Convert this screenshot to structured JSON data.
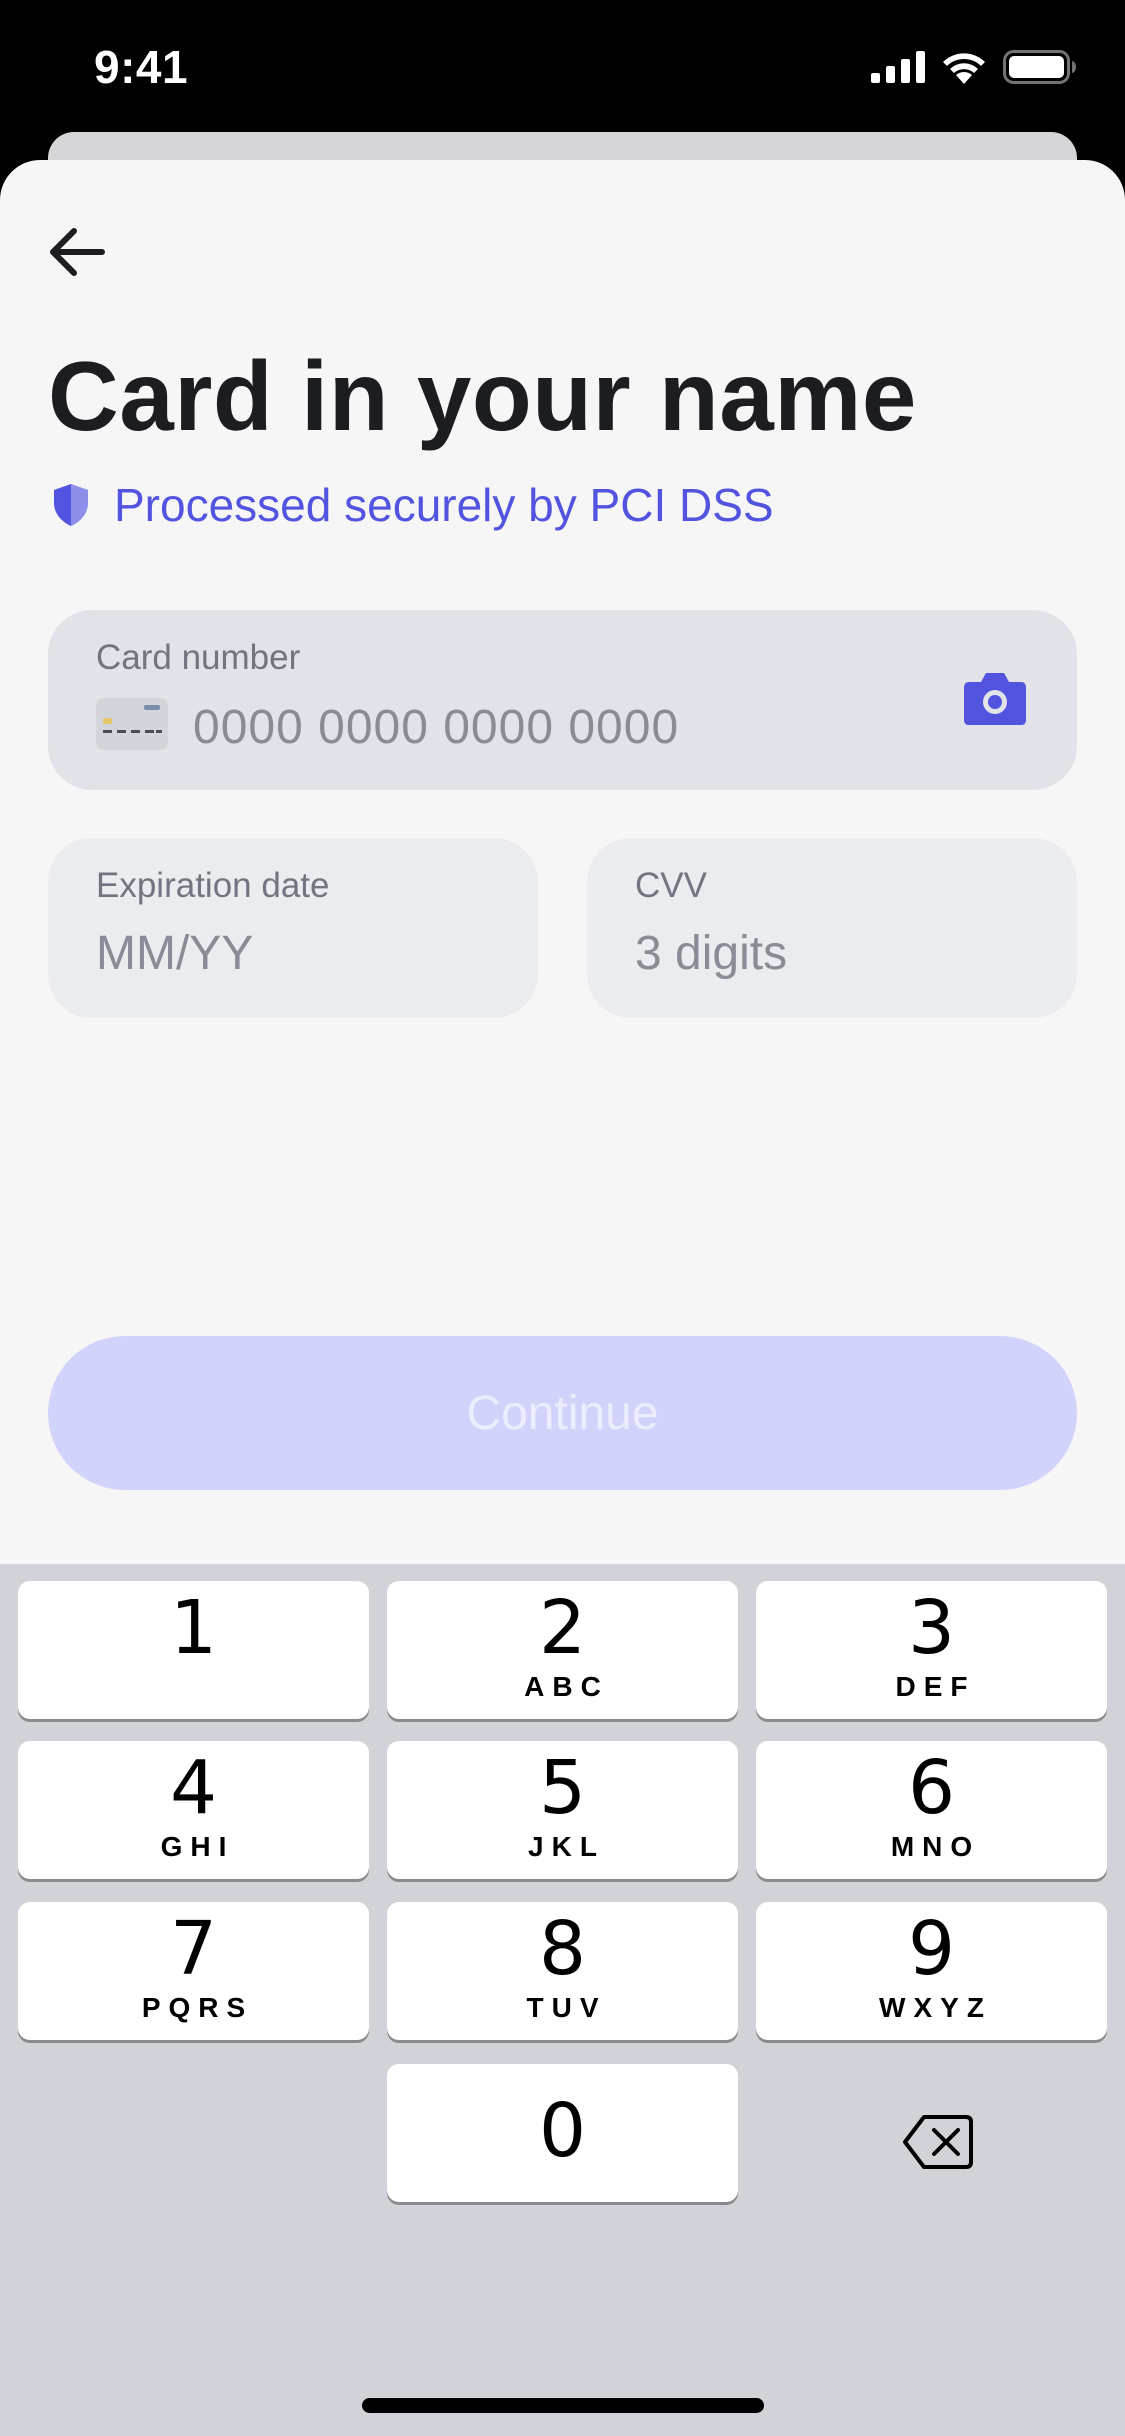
{
  "status_bar": {
    "time": "9:41"
  },
  "header": {
    "title": "Card in your name",
    "secure_text": "Processed securely by PCI DSS"
  },
  "form": {
    "card_number": {
      "label": "Card number",
      "placeholder": "0000 0000 0000 0000",
      "value": ""
    },
    "expiration": {
      "label": "Expiration date",
      "placeholder": "MM/YY",
      "value": ""
    },
    "cvv": {
      "label": "CVV",
      "placeholder": "3 digits",
      "value": ""
    }
  },
  "continue_label": "Continue",
  "keyboard": {
    "keys": [
      {
        "digit": "1",
        "letters": ""
      },
      {
        "digit": "2",
        "letters": "ABC"
      },
      {
        "digit": "3",
        "letters": "DEF"
      },
      {
        "digit": "4",
        "letters": "GHI"
      },
      {
        "digit": "5",
        "letters": "JKL"
      },
      {
        "digit": "6",
        "letters": "MNO"
      },
      {
        "digit": "7",
        "letters": "PQRS"
      },
      {
        "digit": "8",
        "letters": "TUV"
      },
      {
        "digit": "9",
        "letters": "WXYZ"
      },
      {
        "digit": "0",
        "letters": ""
      }
    ]
  },
  "icons": {
    "back": "arrow-left-icon",
    "secure": "shield-icon",
    "card": "credit-card-icon",
    "camera": "camera-icon",
    "delete": "backspace-icon"
  },
  "colors": {
    "accent": "#5254df",
    "title": "#1c1d21",
    "continue_disabled_bg": "#d2d3fa",
    "field_bg": "#e1e3e8",
    "keyboard_bg": "#d1d3d9"
  }
}
